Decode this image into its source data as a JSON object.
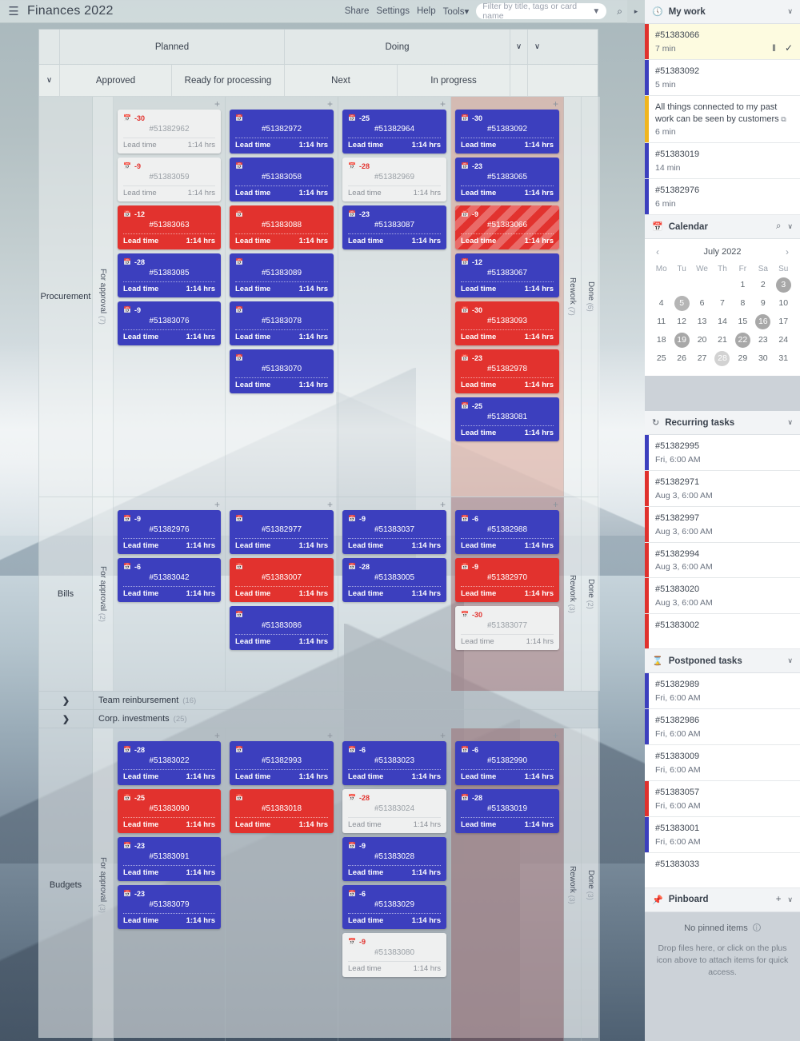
{
  "topbar": {
    "menu_icon": "hamburger-icon",
    "title": "Finances 2022",
    "links": [
      "Share",
      "Settings",
      "Help",
      "Tools"
    ],
    "tools_caret": "▾",
    "filter_placeholder": "Filter by title, tags or card name",
    "funnel_icon": "▼",
    "search_icon": "⌕",
    "collapse_icon": "▸"
  },
  "board": {
    "groups": [
      {
        "label": "Planned",
        "span": 2
      },
      {
        "label": "Doing",
        "span": 2
      }
    ],
    "columns": [
      "Approved",
      "Ready for processing",
      "Next",
      "In progress"
    ],
    "collapsed_columns": [
      {
        "label": "Rework",
        "count": "(7)"
      },
      {
        "label": "Done",
        "count": "(6)"
      }
    ],
    "chevron": "∨",
    "plus": "+",
    "calendar_icon": "☐",
    "lead_time_label": "Lead time",
    "lead_time_value": "1:14 hrs",
    "lanes": [
      {
        "title": "Procurement",
        "approval_label": "For approval",
        "approval_count": "(7)",
        "rework_label": "Rework",
        "rework_count": "(7)",
        "done_label": "Done",
        "done_count": "(6)",
        "cells": [
          [
            {
              "id": "#51382962",
              "day": "-30",
              "style": "white"
            },
            {
              "id": "#51383059",
              "day": "-9",
              "style": "white"
            },
            {
              "id": "#51383063",
              "day": "-12",
              "style": "red"
            },
            {
              "id": "#51383085",
              "day": "-28",
              "style": "blue"
            },
            {
              "id": "#51383076",
              "day": "-9",
              "style": "blue"
            }
          ],
          [
            {
              "id": "#51382972",
              "day": "",
              "style": "blue"
            },
            {
              "id": "#51383058",
              "day": "",
              "style": "blue"
            },
            {
              "id": "#51383088",
              "day": "",
              "style": "red"
            },
            {
              "id": "#51383089",
              "day": "",
              "style": "blue"
            },
            {
              "id": "#51383078",
              "day": "",
              "style": "blue"
            },
            {
              "id": "#51383070",
              "day": "",
              "style": "blue"
            }
          ],
          [
            {
              "id": "#51382964",
              "day": "-25",
              "style": "blue"
            },
            {
              "id": "#51382969",
              "day": "-28",
              "style": "white"
            },
            {
              "id": "#51383087",
              "day": "-23",
              "style": "blue"
            }
          ],
          [
            {
              "id": "#51383092",
              "day": "-30",
              "style": "blue"
            },
            {
              "id": "#51383065",
              "day": "-23",
              "style": "blue"
            },
            {
              "id": "#51383066",
              "day": "-9",
              "style": "striped"
            },
            {
              "id": "#51383067",
              "day": "-12",
              "style": "blue"
            },
            {
              "id": "#51383093",
              "day": "-30",
              "style": "red"
            },
            {
              "id": "#51382978",
              "day": "-23",
              "style": "red"
            },
            {
              "id": "#51383081",
              "day": "-25",
              "style": "blue"
            }
          ]
        ]
      },
      {
        "title": "Bills",
        "approval_label": "For approval",
        "approval_count": "(2)",
        "rework_label": "Rework",
        "rework_count": "(3)",
        "done_label": "Done",
        "done_count": "(2)",
        "cells": [
          [
            {
              "id": "#51382976",
              "day": "-9",
              "style": "blue"
            },
            {
              "id": "#51383042",
              "day": "-6",
              "style": "blue"
            }
          ],
          [
            {
              "id": "#51382977",
              "day": "",
              "style": "blue"
            },
            {
              "id": "#51383007",
              "day": "",
              "style": "red"
            },
            {
              "id": "#51383086",
              "day": "",
              "style": "blue"
            }
          ],
          [
            {
              "id": "#51383037",
              "day": "-9",
              "style": "blue"
            },
            {
              "id": "#51383005",
              "day": "-28",
              "style": "blue"
            }
          ],
          [
            {
              "id": "#51382988",
              "day": "-6",
              "style": "blue"
            },
            {
              "id": "#51382970",
              "day": "-9",
              "style": "red"
            },
            {
              "id": "#51383077",
              "day": "-30",
              "style": "white"
            }
          ]
        ]
      }
    ],
    "collapsed_lanes": [
      {
        "arrow": "❯",
        "name": "Team reinbursement",
        "count": "(16)"
      },
      {
        "arrow": "❯",
        "name": "Corp. investments",
        "count": "(25)"
      }
    ],
    "last_lane": {
      "title": "Budgets",
      "approval_label": "For approval",
      "approval_count": "(3)",
      "rework_label": "Rework",
      "rework_count": "(3)",
      "done_label": "Done",
      "done_count": "(3)",
      "cells": [
        [
          {
            "id": "#51383022",
            "day": "-28",
            "style": "blue"
          },
          {
            "id": "#51383090",
            "day": "-25",
            "style": "red"
          },
          {
            "id": "#51383091",
            "day": "-23",
            "style": "blue"
          },
          {
            "id": "#51383079",
            "day": "-23",
            "style": "blue"
          }
        ],
        [
          {
            "id": "#51382993",
            "day": "",
            "style": "blue"
          },
          {
            "id": "#51383018",
            "day": "",
            "style": "red"
          }
        ],
        [
          {
            "id": "#51383023",
            "day": "-6",
            "style": "blue"
          },
          {
            "id": "#51383024",
            "day": "-28",
            "style": "white"
          },
          {
            "id": "#51383028",
            "day": "-9",
            "style": "blue"
          },
          {
            "id": "#51383029",
            "day": "-6",
            "style": "blue"
          },
          {
            "id": "#51383080",
            "day": "-9",
            "style": "white"
          }
        ],
        [
          {
            "id": "#51382990",
            "day": "-6",
            "style": "blue"
          },
          {
            "id": "#51383019",
            "day": "-28",
            "style": "blue"
          }
        ]
      ]
    }
  },
  "sidebar": {
    "my_work": {
      "icon": "clock-icon",
      "title": "My work",
      "caret": "∨",
      "items": [
        {
          "title": "#51383066",
          "time": "7 min",
          "color": "#e0312d",
          "active": true,
          "pause": "‖",
          "check": "✓"
        },
        {
          "title": "#51383092",
          "time": "5 min",
          "color": "#3c3fbe",
          "active": false
        },
        {
          "title": "All things connected to my past work can be seen by customers",
          "time": "6 min",
          "color": "#f0b51e",
          "active": false,
          "external": "⧉"
        },
        {
          "title": "#51383019",
          "time": "14 min",
          "color": "#3c3fbe",
          "active": false
        },
        {
          "title": "#51382976",
          "time": "6 min",
          "color": "#3c3fbe",
          "active": false
        }
      ]
    },
    "calendar": {
      "icon": "calendar-icon",
      "title": "Calendar",
      "search_icon": "⌕",
      "caret": "∨",
      "prev": "‹",
      "next": "›",
      "month": "July 2022",
      "weekdays": [
        "Mo",
        "Tu",
        "We",
        "Th",
        "Fr",
        "Sa",
        "Su"
      ],
      "weeks": [
        [
          "",
          "",
          "",
          "",
          "1",
          "2",
          "3"
        ],
        [
          "4",
          "5",
          "6",
          "7",
          "8",
          "9",
          "10"
        ],
        [
          "11",
          "12",
          "13",
          "14",
          "15",
          "16",
          "17"
        ],
        [
          "18",
          "19",
          "20",
          "21",
          "22",
          "23",
          "24"
        ],
        [
          "25",
          "26",
          "27",
          "28",
          "29",
          "30",
          "31"
        ]
      ],
      "highlights": {
        "3": "dark",
        "5": "mid",
        "16": "dark",
        "19": "dark",
        "22": "dark",
        "28": "light"
      }
    },
    "recurring": {
      "icon": "refresh-icon",
      "title": "Recurring tasks",
      "caret": "∨",
      "items": [
        {
          "title": "#51382995",
          "time": "Fri, 6:00 AM",
          "color": "#3c3fbe"
        },
        {
          "title": "#51382971",
          "time": "Aug 3, 6:00 AM",
          "color": "#e0312d"
        },
        {
          "title": "#51382997",
          "time": "Aug 3, 6:00 AM",
          "color": "#e0312d"
        },
        {
          "title": "#51382994",
          "time": "Aug 3, 6:00 AM",
          "color": "#e0312d"
        },
        {
          "title": "#51383020",
          "time": "Aug 3, 6:00 AM",
          "color": "#e0312d"
        },
        {
          "title": "#51383002",
          "time": "",
          "color": "#e0312d"
        }
      ]
    },
    "postponed": {
      "icon": "hourglass-icon",
      "title": "Postponed tasks",
      "caret": "∨",
      "items": [
        {
          "title": "#51382989",
          "time": "Fri, 6:00 AM",
          "color": "#3c3fbe"
        },
        {
          "title": "#51382986",
          "time": "Fri, 6:00 AM",
          "color": "#3c3fbe"
        },
        {
          "title": "#51383009",
          "time": "Fri, 6:00 AM",
          "color": "#ffffff"
        },
        {
          "title": "#51383057",
          "time": "Fri, 6:00 AM",
          "color": "#e0312d"
        },
        {
          "title": "#51383001",
          "time": "Fri, 6:00 AM",
          "color": "#3c3fbe"
        },
        {
          "title": "#51383033",
          "time": "",
          "color": "#ffffff"
        }
      ]
    },
    "pinboard": {
      "icon": "pin-icon",
      "title": "Pinboard",
      "plus": "+",
      "caret": "∨",
      "empty_title": "No pinned items",
      "info_icon": "i",
      "empty_sub": "Drop files here, or click on the plus icon above to attach items for quick access."
    }
  }
}
